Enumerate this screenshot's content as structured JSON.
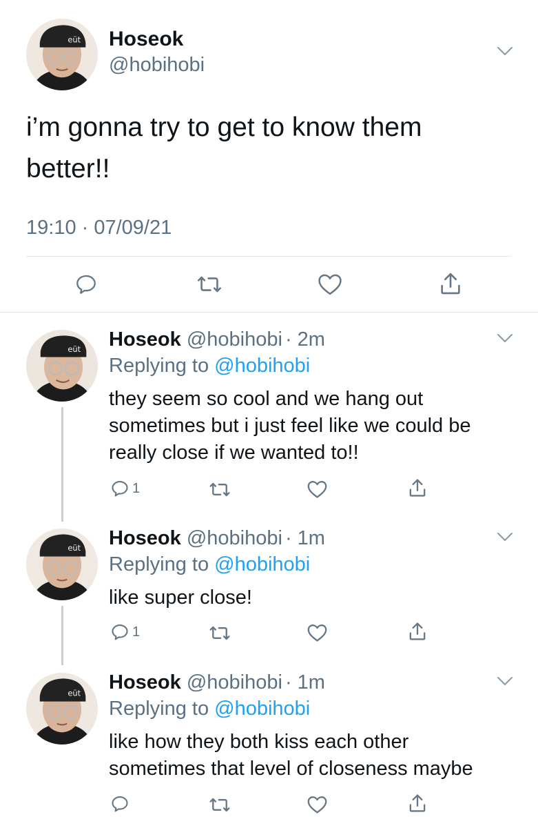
{
  "main_tweet": {
    "name": "Hoseok",
    "handle": "@hobihobi",
    "text_line1": "i’m gonna try to get to know them",
    "text_line2": "better!!",
    "timestamp": "19:10 · 07/09/21"
  },
  "replies": [
    {
      "name": "Hoseok",
      "handle": "@hobihobi",
      "time": "· 2m",
      "replying_prefix": "Replying to",
      "replying_handle": "@hobihobi",
      "lines": [
        "they seem so cool and we hang out",
        "sometimes but i just feel like we could be",
        "really close if we wanted to!!"
      ],
      "reply_count": "1"
    },
    {
      "name": "Hoseok",
      "handle": "@hobihobi",
      "time": "· 1m",
      "replying_prefix": "Replying to",
      "replying_handle": "@hobihobi",
      "lines": [
        "like super close!"
      ],
      "reply_count": "1"
    },
    {
      "name": "Hoseok",
      "handle": "@hobihobi",
      "time": "· 1m",
      "replying_prefix": "Replying to",
      "replying_handle": "@hobihobi",
      "lines": [
        "like how they both kiss each other",
        "sometimes that level of closeness maybe"
      ],
      "reply_count": ""
    }
  ],
  "icons": [
    "reply-icon",
    "retweet-icon",
    "like-icon",
    "share-icon",
    "chevron-down-icon"
  ],
  "colors": {
    "text": "#0f1419",
    "secondary": "#5b7083",
    "link": "#1da1f2",
    "divider": "#e1e8ed"
  }
}
